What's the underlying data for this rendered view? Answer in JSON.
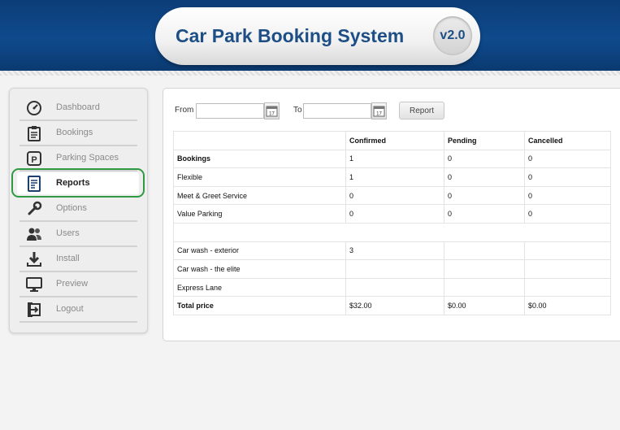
{
  "header": {
    "title": "Car Park Booking System",
    "version": "v2.0"
  },
  "sidebar": {
    "items": [
      {
        "label": "Dashboard",
        "icon": "dashboard-gauge-icon",
        "active": false
      },
      {
        "label": "Bookings",
        "icon": "clipboard-icon",
        "active": false
      },
      {
        "label": "Parking Spaces",
        "icon": "parking-icon",
        "active": false
      },
      {
        "label": "Reports",
        "icon": "report-document-icon",
        "active": true
      },
      {
        "label": "Options",
        "icon": "wrench-icon",
        "active": false
      },
      {
        "label": "Users",
        "icon": "users-icon",
        "active": false
      },
      {
        "label": "Install",
        "icon": "download-icon",
        "active": false
      },
      {
        "label": "Preview",
        "icon": "monitor-icon",
        "active": false
      },
      {
        "label": "Logout",
        "icon": "logout-icon",
        "active": false
      }
    ]
  },
  "filters": {
    "from_label": "From",
    "from_value": "",
    "to_label": "To",
    "to_value": "",
    "calendar_icon_text": "17",
    "report_button": "Report"
  },
  "table": {
    "headers": [
      "",
      "Confirmed",
      "Pending",
      "Cancelled"
    ],
    "rows": [
      {
        "label": "Bookings",
        "bold": true,
        "cells": [
          "1",
          "0",
          "0"
        ]
      },
      {
        "label": "Flexible",
        "bold": false,
        "cells": [
          "1",
          "0",
          "0"
        ]
      },
      {
        "label": "Meet & Greet Service",
        "bold": false,
        "cells": [
          "0",
          "0",
          "0"
        ]
      },
      {
        "label": "Value Parking",
        "bold": false,
        "cells": [
          "0",
          "0",
          "0"
        ]
      },
      {
        "label": "",
        "bold": false,
        "cells": [],
        "spacer": true
      },
      {
        "label": "Car wash - exterior",
        "bold": false,
        "cells": [
          "3",
          "",
          ""
        ]
      },
      {
        "label": "Car wash - the elite",
        "bold": false,
        "cells": [
          "",
          "",
          ""
        ]
      },
      {
        "label": "Express Lane",
        "bold": false,
        "cells": [
          "",
          "",
          ""
        ]
      },
      {
        "label": "Total price",
        "bold": true,
        "cells": [
          "$32.00",
          "$0.00",
          "$0.00"
        ]
      }
    ]
  },
  "colors": {
    "header_blue": "#0f4a8c",
    "title_blue": "#1d4f86",
    "active_ring": "#2f9a43"
  }
}
